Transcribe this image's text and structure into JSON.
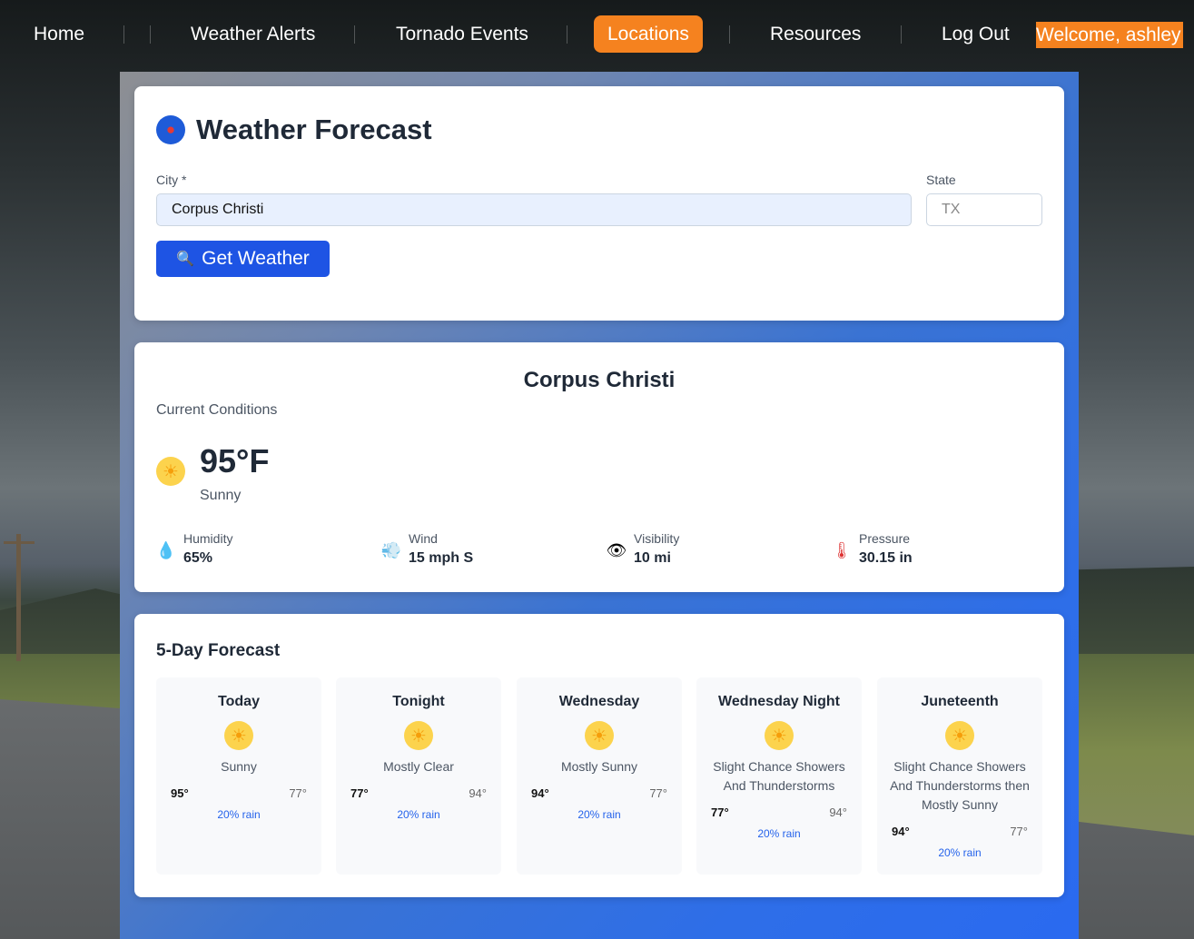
{
  "nav": {
    "items": [
      {
        "label": "Home"
      },
      {
        "label": "Weather Alerts"
      },
      {
        "label": "Tornado Events"
      },
      {
        "label": "Locations",
        "active": true
      },
      {
        "label": "Resources"
      },
      {
        "label": "Log Out"
      }
    ],
    "welcome": "Welcome, ashley"
  },
  "search": {
    "title": "Weather Forecast",
    "city_label": "City *",
    "city_value": "Corpus Christi",
    "state_label": "State",
    "state_placeholder": "TX",
    "button_label": "Get Weather"
  },
  "current": {
    "city": "Corpus Christi",
    "section_label": "Current Conditions",
    "temperature": "95°F",
    "description": "Sunny",
    "stats": [
      {
        "label": "Humidity",
        "value": "65%",
        "icon": "droplet-icon"
      },
      {
        "label": "Wind",
        "value": "15 mph S",
        "icon": "wind-icon"
      },
      {
        "label": "Visibility",
        "value": "10 mi",
        "icon": "eye-icon"
      },
      {
        "label": "Pressure",
        "value": "30.15 in",
        "icon": "thermometer-icon"
      }
    ]
  },
  "forecast": {
    "title": "5-Day Forecast",
    "days": [
      {
        "name": "Today",
        "desc": "Sunny",
        "hi": "95°",
        "lo": "77°",
        "rain": "20% rain"
      },
      {
        "name": "Tonight",
        "desc": "Mostly Clear",
        "hi": "77°",
        "lo": "94°",
        "rain": "20% rain"
      },
      {
        "name": "Wednesday",
        "desc": "Mostly Sunny",
        "hi": "94°",
        "lo": "77°",
        "rain": "20% rain"
      },
      {
        "name": "Wednesday Night",
        "desc": "Slight Chance Showers And Thunderstorms",
        "hi": "77°",
        "lo": "94°",
        "rain": "20% rain"
      },
      {
        "name": "Juneteenth",
        "desc": "Slight Chance Showers And Thunderstorms then Mostly Sunny",
        "hi": "94°",
        "lo": "77°",
        "rain": "20% rain"
      }
    ]
  },
  "colors": {
    "accent_orange": "#f5821f",
    "primary_blue": "#1e54e4",
    "rain_blue": "#2563eb"
  }
}
